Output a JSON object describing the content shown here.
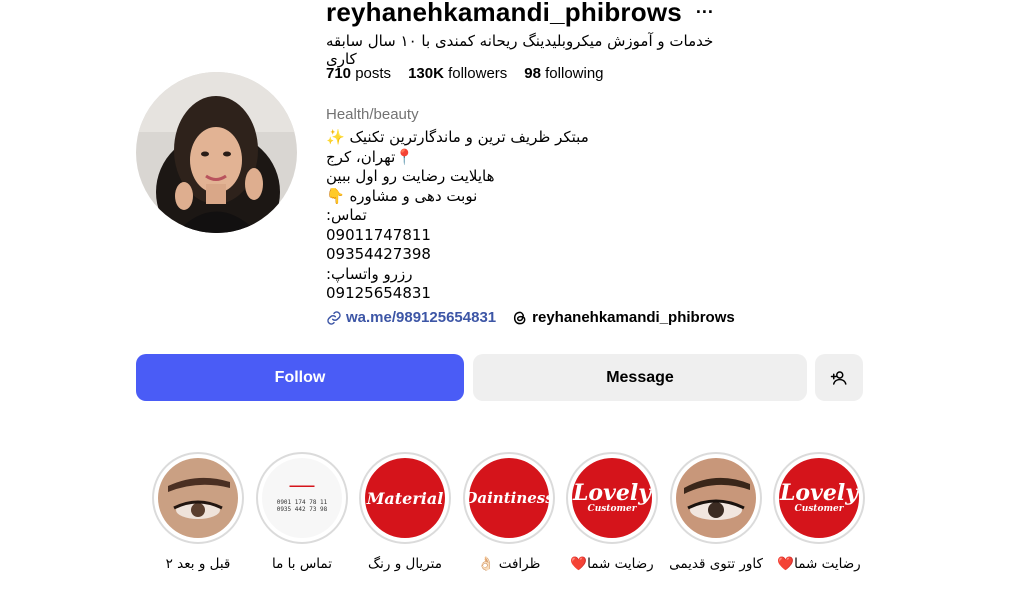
{
  "profile": {
    "username": "reyhanehkamandi_phibrows",
    "more_label": "···",
    "full_name": "خدمات و آموزش میکروبلیدینگ ریحانه کمندی با ۱۰ سال سابقه کاری",
    "stats": {
      "posts_count": "710",
      "posts_label": "posts",
      "followers_count": "130K",
      "followers_label": "followers",
      "following_count": "98",
      "following_label": "following"
    },
    "category": "Health/beauty",
    "bio_lines": [
      "مبتکر ظریف ترین و ماندگارترین تکنیک ✨",
      "📍تهران، کرج",
      "هایلایت رضایت رو اول ببین",
      "نوبت دهی و مشاوره 👇",
      "تماس:",
      "09011747811",
      "09354427398",
      "رزرو واتساپ:",
      "09125654831"
    ],
    "website": "wa.me/989125654831",
    "threads_handle": "reyhanehkamandi_phibrows"
  },
  "actions": {
    "follow_label": "Follow",
    "message_label": "Message",
    "add_user_icon": "person-add-icon"
  },
  "highlights": [
    {
      "label": "رضایت شما❤️",
      "cover": "Lovely",
      "cover_sub": "Customer",
      "type": "red"
    },
    {
      "label": "کاور تتوی قدیمی",
      "cover": "",
      "type": "photo"
    },
    {
      "label": "رضایت شما❤️",
      "cover": "Lovely",
      "cover_sub": "Customer",
      "type": "red"
    },
    {
      "label": "ظرافت 👌🏻",
      "cover": "Daintiness",
      "type": "red"
    },
    {
      "label": "متریال و رنگ",
      "cover": "Material",
      "type": "red"
    },
    {
      "label": "تماس با ما",
      "cover": "0901 174 78 11",
      "cover_sub": "0935 442 73 98",
      "type": "white"
    },
    {
      "label": "قبل و بعد ۲",
      "cover": "",
      "type": "photo"
    }
  ],
  "colors": {
    "follow_blue": "#4a5cf6",
    "highlight_red": "#d5141b",
    "secondary_button": "#efefef",
    "link_blue": "#3d56a6"
  }
}
